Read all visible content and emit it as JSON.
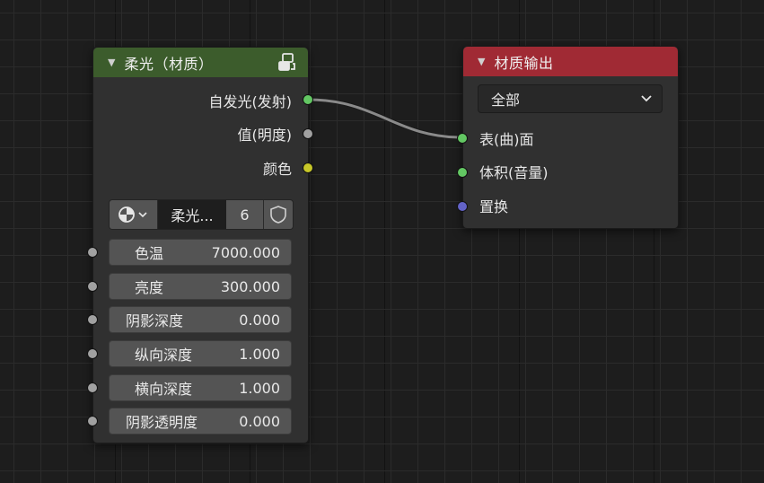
{
  "colors": {
    "shader_header": "#3c5c2c",
    "output_header": "#a02a34",
    "socket_shader": "#63c763",
    "socket_value": "#a1a1a1",
    "socket_color": "#c7c729",
    "socket_vector": "#6363c7",
    "link": "#8a8a8a"
  },
  "light_node": {
    "title": "柔光（材质）",
    "header_icon": "node-group-icon",
    "outputs": [
      {
        "label": "自发光(发射)",
        "socket": "shader"
      },
      {
        "label": "值(明度)",
        "socket": "value"
      },
      {
        "label": "颜色",
        "socket": "color"
      }
    ],
    "datablock": {
      "browse_icon": "material-sphere-icon",
      "name": "柔光...",
      "users": "6",
      "fake_user_icon": "shield-icon"
    },
    "fields": [
      {
        "label": "色温",
        "value": "7000.000"
      },
      {
        "label": "亮度",
        "value": "300.000"
      },
      {
        "label": "阴影深度",
        "value": "0.000"
      },
      {
        "label": "纵向深度",
        "value": "1.000"
      },
      {
        "label": "横向深度",
        "value": "1.000"
      },
      {
        "label": "阴影透明度",
        "value": "0.000"
      }
    ]
  },
  "output_node": {
    "title": "材质输出",
    "target": "全部",
    "inputs": [
      {
        "label": "表(曲)面",
        "socket": "shader"
      },
      {
        "label": "体积(音量)",
        "socket": "shader"
      },
      {
        "label": "置换",
        "socket": "vector"
      }
    ]
  }
}
